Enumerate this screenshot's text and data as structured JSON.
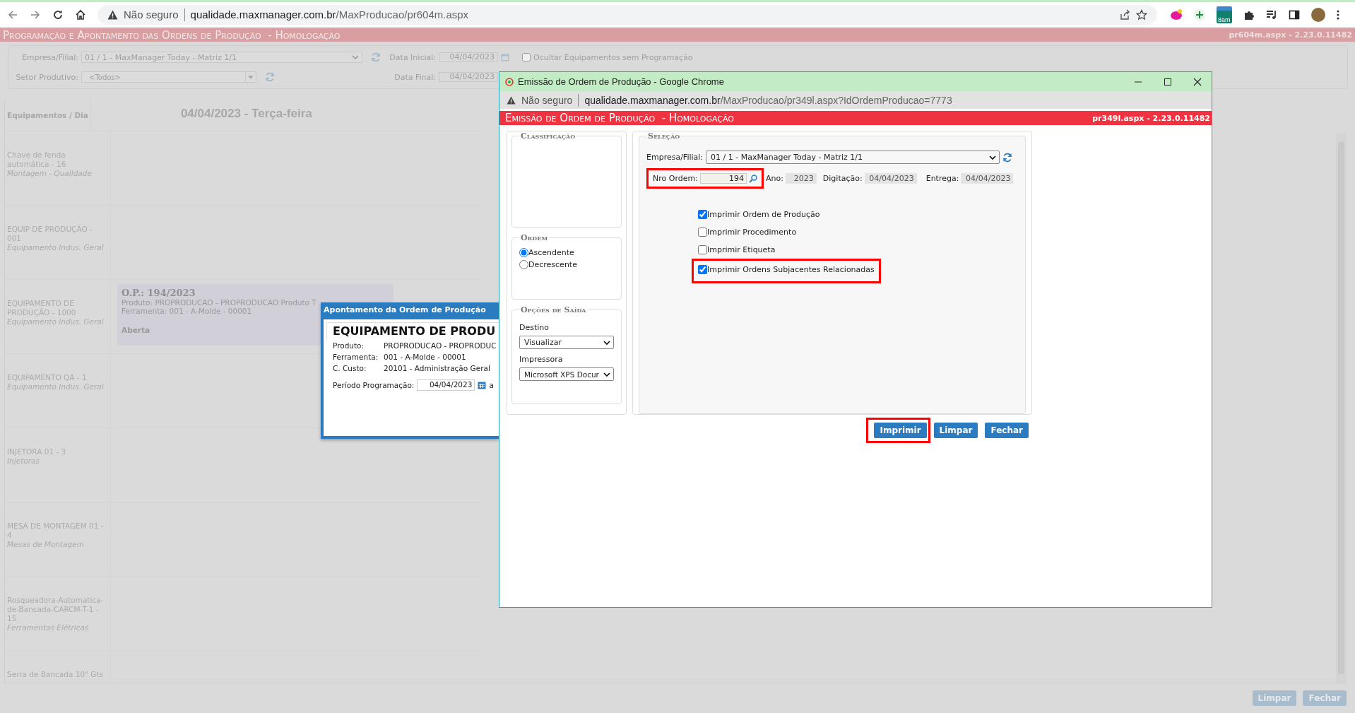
{
  "browser": {
    "security_label": "Não seguro",
    "url_host": "qualidade.maxmanager.com.br",
    "url_path": "/MaxProducao/pr604m.aspx",
    "extension_badge": "8am"
  },
  "page": {
    "title": "Programação e Apontamento das Ordens de Produção  - Homologação",
    "version": "pr604m.aspx - 2.23.0.11482"
  },
  "filters": {
    "company_label": "Empresa/Filial:",
    "company_value": "01 / 1 - MaxManager Today - Matriz 1/1",
    "start_label": "Data Inicial:",
    "start_value": "04/04/2023",
    "hide_label": "Ocultar Equipamentos sem Programação",
    "hide_checked": false,
    "sector_label": "Setor Produtivo:",
    "sector_value": "<Todos>",
    "end_label": "Data Final:",
    "end_value": "04/04/2023"
  },
  "schedule": {
    "corner": "Equipamentos / Dia",
    "day": "04/04/2023 - Terça-feira",
    "rows": [
      {
        "name": "Chave de fenda automática - 16",
        "group": "Montagem - Qualidade"
      },
      {
        "name": "EQUIP DE PRODUÇÃO - 001",
        "group": "Equipamento Indus. Geral"
      },
      {
        "name": "EQUIPAMENTO DE PRODUÇÃO - 1000",
        "group": "Equipamento Indus. Geral",
        "order": {
          "title": "O.P.: 194/2023",
          "product": "Produto: PROPRODUCAO - PROPRODUCAO Produto T",
          "tool": "Ferramenta: 001 - A-Molde - 00001",
          "status": "Aberta"
        }
      },
      {
        "name": "EQUIPAMENTO QA - 1",
        "group": "Equipamento Indus. Geral"
      },
      {
        "name": "INJETORA 01 - 3",
        "group": "Injetoras"
      },
      {
        "name": "MESA DE MONTAGEM 01 - 4",
        "group": "Mesas de Montagem"
      },
      {
        "name": "Rosqueadora-Automatica-de-Bancada-CARCM-T-1 - 15",
        "group": "Ferramentas Elétricas"
      },
      {
        "name": "Serra de Bancada 10\" Gts"
      }
    ]
  },
  "footer_buttons": [
    "Limpar",
    "Fechar"
  ],
  "apontamento": {
    "title": "Apontamento da Ordem de Produção",
    "heading": "EQUIPAMENTO DE PRODU",
    "fields": [
      {
        "label": "Produto:",
        "value": "PROPRODUCAO - PROPRODUC"
      },
      {
        "label": "Ferramenta:",
        "value": "001 - A-Molde - 00001"
      },
      {
        "label": "C. Custo:",
        "value": "20101 - Administração Geral"
      }
    ],
    "period_label": "Período Programação:",
    "period_start": "04/04/2023",
    "period_separator": "a"
  },
  "popup": {
    "window_title": "Emissão de Ordem de Produção - Google Chrome",
    "security_label": "Não seguro",
    "url_host": "qualidade.maxmanager.com.br",
    "url_path": "/MaxProducao/pr349l.aspx?IdOrdemProducao=7773",
    "title": "Emissão de Ordem de Produção  - Homologação",
    "version": "pr349l.aspx - 2.23.0.11482",
    "classification_legend": "Classificação",
    "order_legend": "Ordem",
    "sort_options": [
      {
        "label": "Ascendente",
        "selected": true
      },
      {
        "label": "Decrescente",
        "selected": false
      }
    ],
    "output_legend": "Opções de Saída",
    "destination_label": "Destino",
    "destination_value": "Visualizar",
    "printer_label": "Impressora",
    "printer_value": "Microsoft XPS Docur",
    "selection_legend": "Seleção",
    "company_label": "Empresa/Filial:",
    "company_value": "01 / 1 - MaxManager Today - Matriz 1/1",
    "order_number": {
      "label": "Nro Ordem:",
      "value": "194",
      "highlighted": true
    },
    "year_label": "Ano:",
    "year_value": "2023",
    "entry_label": "Digitação:",
    "entry_value": "04/04/2023",
    "delivery_label": "Entrega:",
    "delivery_value": "04/04/2023",
    "options": [
      {
        "label": "Imprimir Ordem de Produção",
        "checked": true,
        "highlighted": false
      },
      {
        "label": "Imprimir Procedimento",
        "checked": false,
        "highlighted": false
      },
      {
        "label": "Imprimir Etiqueta",
        "checked": false,
        "highlighted": false
      },
      {
        "label": "Imprimir Ordens Subjacentes Relacionadas",
        "checked": true,
        "highlighted": true
      }
    ],
    "buttons": [
      {
        "label": "Imprimir",
        "highlighted": true
      },
      {
        "label": "Limpar",
        "highlighted": false
      },
      {
        "label": "Fechar",
        "highlighted": false
      }
    ]
  }
}
